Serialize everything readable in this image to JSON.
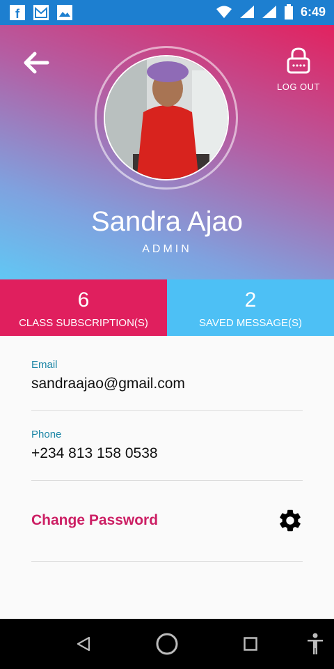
{
  "status_bar": {
    "time": "6:49",
    "left_icons": [
      "facebook-icon",
      "gmail-icon",
      "gallery-icon"
    ],
    "right_icons": [
      "wifi-icon",
      "signal-icon",
      "signal-icon",
      "battery-icon"
    ],
    "color": "#1d7fd0"
  },
  "header": {
    "logout_label": "LOG OUT"
  },
  "profile": {
    "name": "Sandra Ajao",
    "role": "ADMIN"
  },
  "stats": [
    {
      "count": "6",
      "label": "CLASS SUBSCRIPTION(S)",
      "color": "#e01f5e"
    },
    {
      "count": "2",
      "label": "SAVED MESSAGE(S)",
      "color": "#4dc0f5"
    }
  ],
  "details": {
    "email_label": "Email",
    "email_value": "sandraajao@gmail.com",
    "phone_label": "Phone",
    "phone_value": "+234 813 158 0538",
    "change_password_label": "Change Password"
  },
  "colors": {
    "accent_pink": "#cc1f64",
    "label_teal": "#1c86a6"
  }
}
